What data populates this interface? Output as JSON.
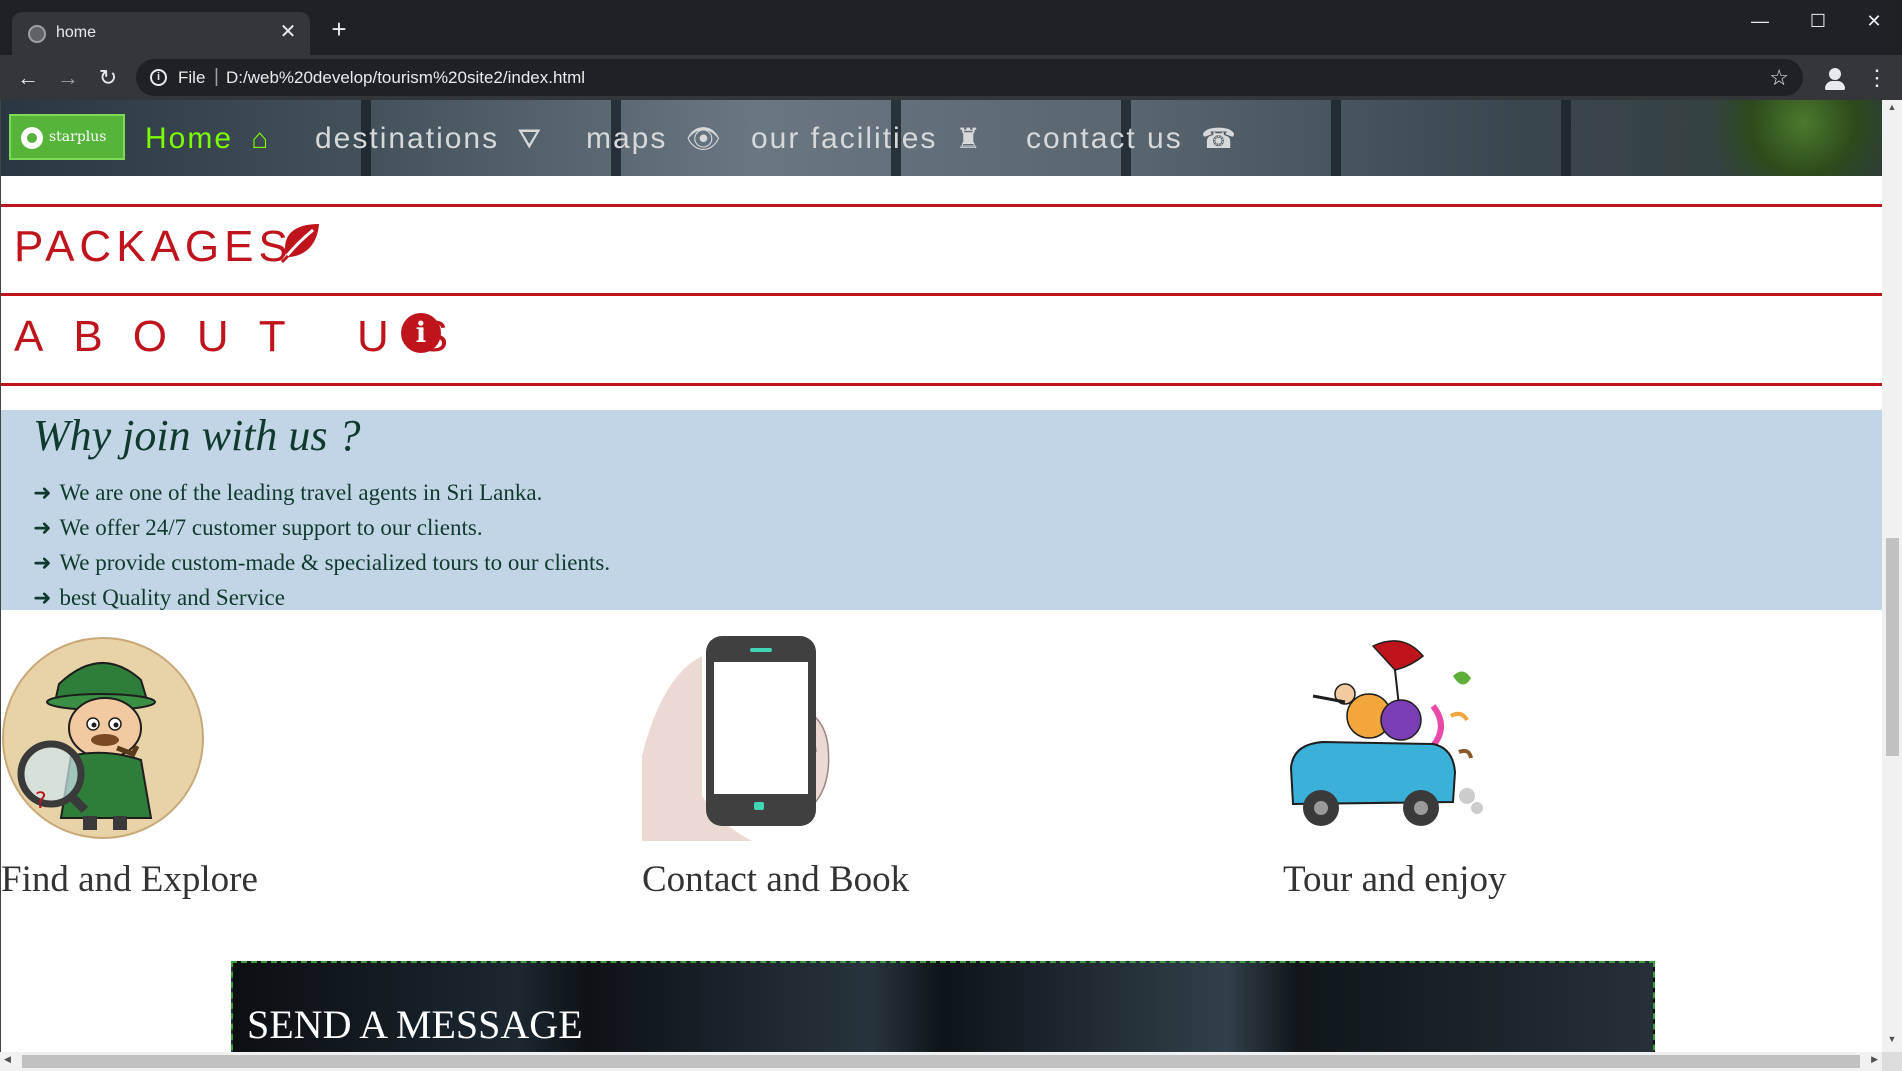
{
  "browser": {
    "tab_title": "home",
    "tab_close": "✕",
    "new_tab": "+",
    "url_scheme": "File",
    "url_separator": "|",
    "url": "D:/web%20develop/tourism%20site2/index.html",
    "window_controls": {
      "minimize": "—",
      "maximize": "☐",
      "close": "✕"
    },
    "nav": {
      "back": "←",
      "forward": "→",
      "reload": "↻"
    },
    "info_icon": "i",
    "star_icon": "☆",
    "menu_icon": "⋮"
  },
  "site": {
    "logo_text": "starplus",
    "nav": [
      {
        "label": "Home",
        "icon": "⌂",
        "icon_name": "home-icon",
        "active": true
      },
      {
        "label": "destinations",
        "icon": "⛛",
        "icon_name": "road-icon"
      },
      {
        "label": "maps",
        "icon": "👁",
        "icon_name": "eye-icon"
      },
      {
        "label": "our facilities",
        "icon": "♜",
        "icon_name": "chess-icon"
      },
      {
        "label": "contact us",
        "icon": "☎",
        "icon_name": "phone-icon"
      }
    ],
    "sections": {
      "packages": "PACKAGES",
      "about": "ABOUT US",
      "info_glyph": "i"
    },
    "why": {
      "title": "Why join with us ?",
      "arrow": "➜",
      "items": [
        "We are one of the leading travel agents in Sri Lanka.",
        "We offer 24/7 customer support to our clients.",
        "We provide custom-made & specialized tours to our clients.",
        "best Quality and Service"
      ]
    },
    "features": [
      {
        "caption": "Find and Explore",
        "image": "detective-illustration"
      },
      {
        "caption": "Contact and Book",
        "image": "phone-in-hand-illustration"
      },
      {
        "caption": "Tour and enjoy",
        "image": "car-with-tourists-illustration"
      }
    ],
    "message": {
      "title": "SEND A MESSAGE"
    }
  },
  "colors": {
    "accent_red": "#c0141c",
    "nav_active": "#7cfc00",
    "why_bg": "#c2d5e6",
    "why_text": "#0f3a2d",
    "logo_green": "#56b43a"
  }
}
